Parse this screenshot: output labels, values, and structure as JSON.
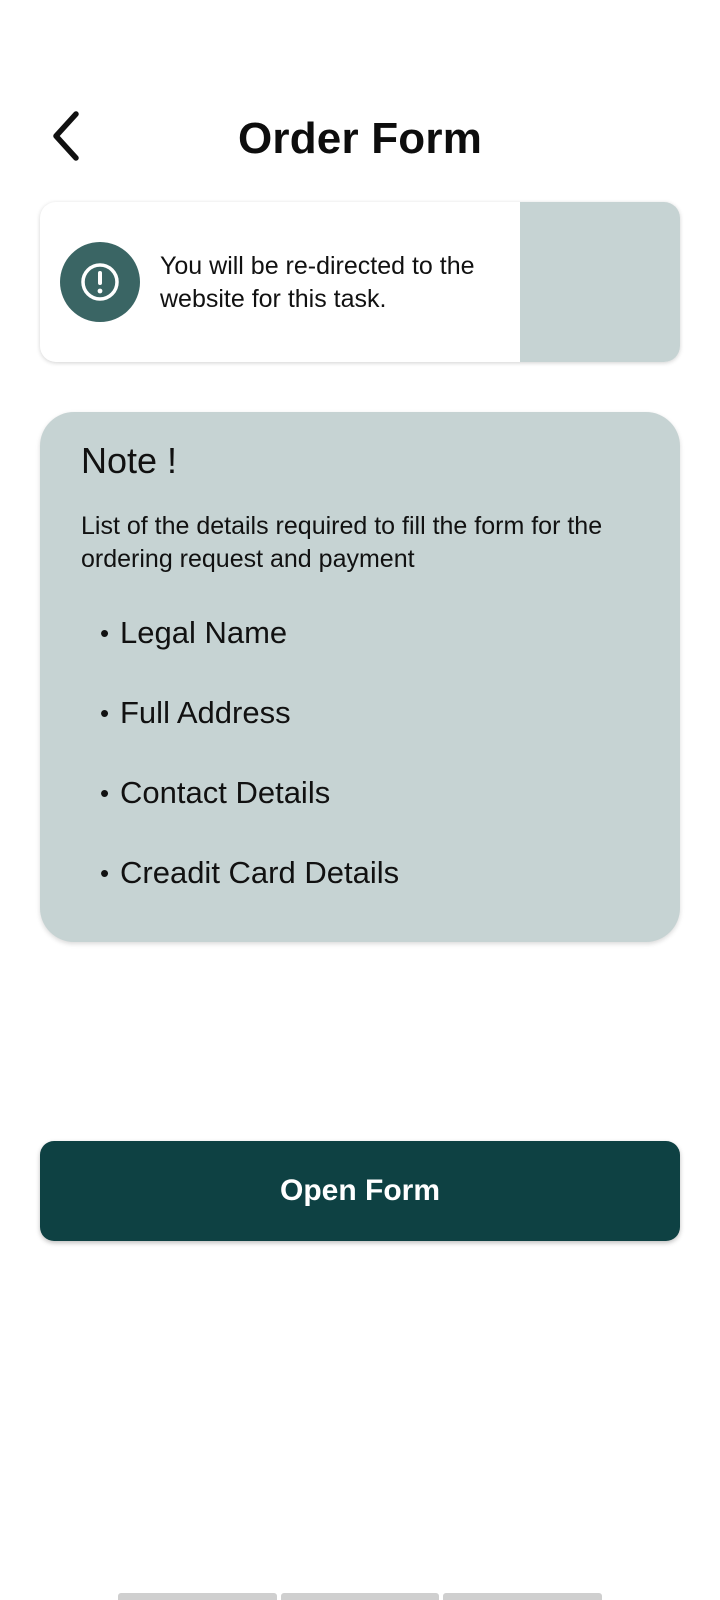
{
  "header": {
    "title": "Order Form",
    "back_icon": "chevron-left-icon"
  },
  "info_card": {
    "icon": "alert-circle-icon",
    "message": "You will be re-directed to the website for this task.",
    "icon_bg": "#3a6564",
    "panel_color": "#c6d3d3"
  },
  "note": {
    "title": "Note !",
    "description": "List of the details required to fill the form for the ordering request and payment",
    "items": [
      "Legal Name",
      "Full Address",
      "Contact Details",
      "Creadit Card Details"
    ],
    "background": "#c6d3d3"
  },
  "actions": {
    "open_form_label": "Open Form",
    "button_color": "#0e4143"
  }
}
